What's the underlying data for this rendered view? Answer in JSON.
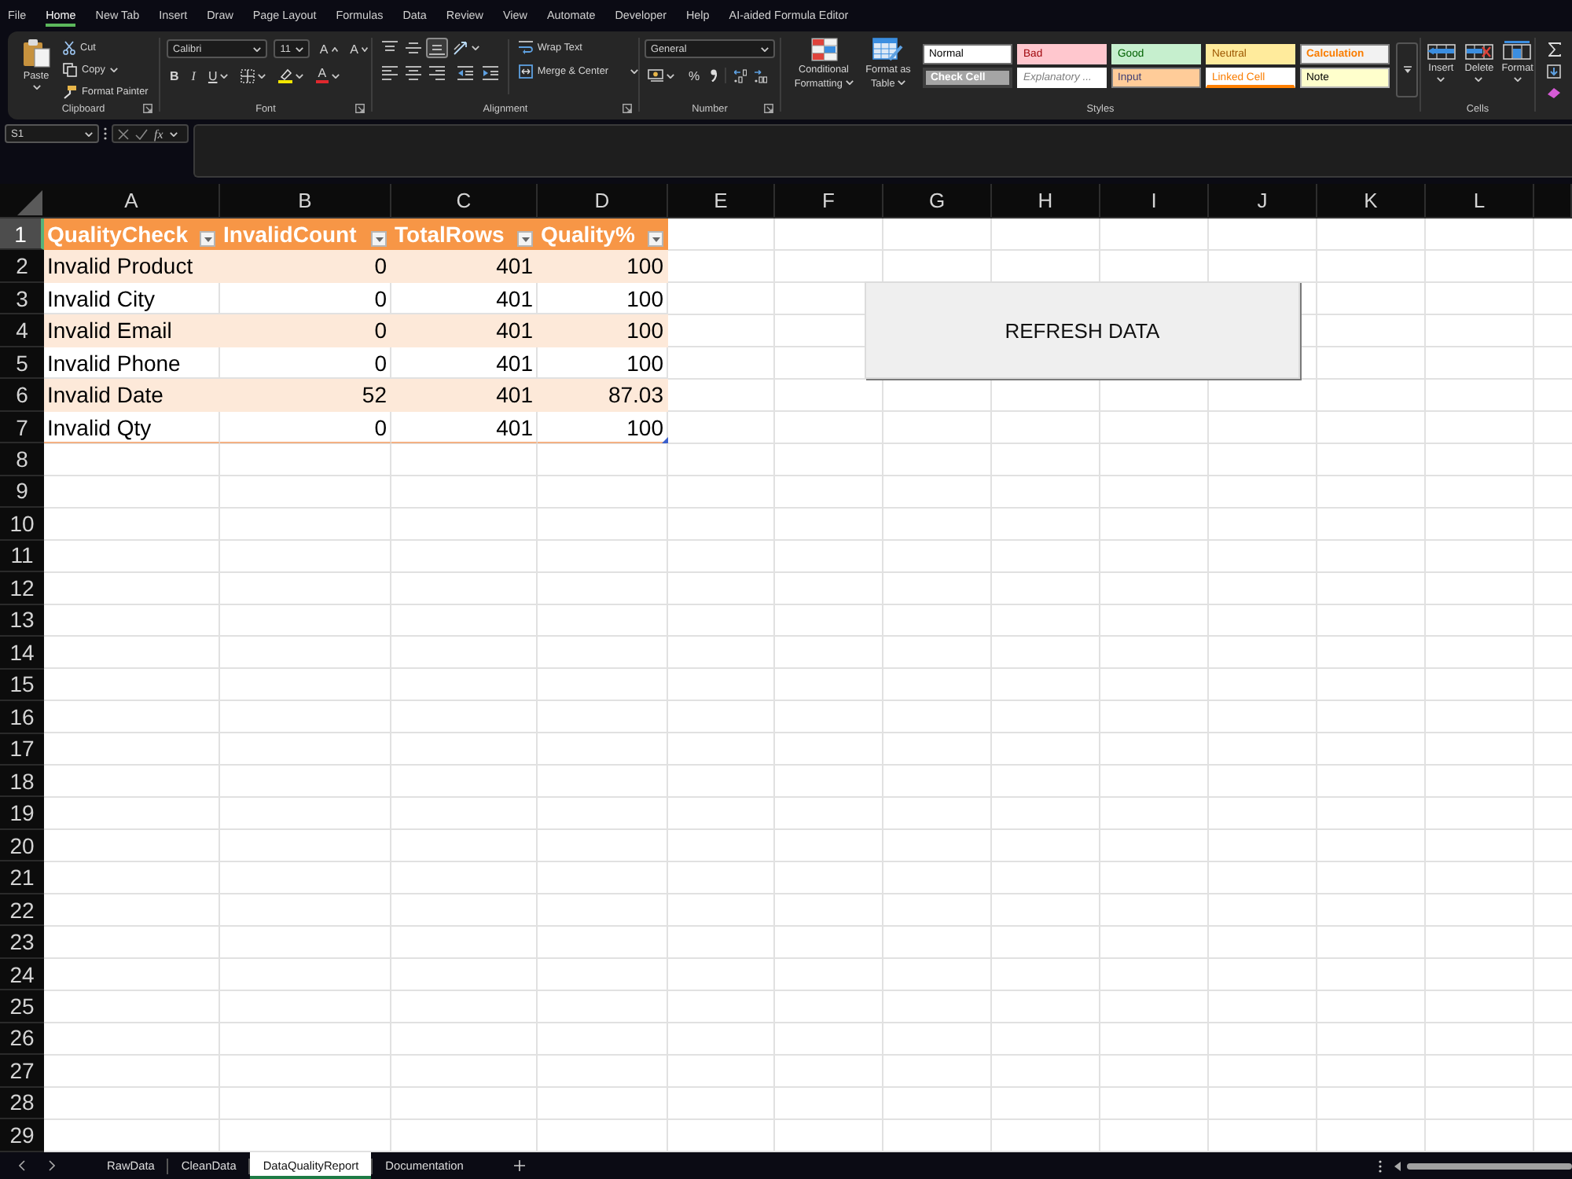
{
  "menu_tabs": [
    {
      "label": "File",
      "selected": false
    },
    {
      "label": "Home",
      "selected": true
    },
    {
      "label": "New Tab",
      "selected": false
    },
    {
      "label": "Insert",
      "selected": false
    },
    {
      "label": "Draw",
      "selected": false
    },
    {
      "label": "Page Layout",
      "selected": false
    },
    {
      "label": "Formulas",
      "selected": false
    },
    {
      "label": "Data",
      "selected": false
    },
    {
      "label": "Review",
      "selected": false
    },
    {
      "label": "View",
      "selected": false
    },
    {
      "label": "Automate",
      "selected": false
    },
    {
      "label": "Developer",
      "selected": false
    },
    {
      "label": "Help",
      "selected": false
    },
    {
      "label": "AI-aided Formula Editor",
      "selected": false
    }
  ],
  "ribbon": {
    "clipboard": {
      "label": "Clipboard",
      "paste": "Paste",
      "cut": "Cut",
      "copy": "Copy",
      "format_painter": "Format Painter"
    },
    "font": {
      "label": "Font",
      "font_name": "Calibri",
      "font_size": "11",
      "grow": "A",
      "shrink": "A",
      "bold": "B",
      "italic": "I",
      "underline": "U",
      "font_color": "A"
    },
    "alignment": {
      "label": "Alignment",
      "align_buttons": [
        {
          "kind": "top",
          "selected": false
        },
        {
          "kind": "middle",
          "selected": false
        },
        {
          "kind": "bottom",
          "selected": true
        },
        {
          "kind": "left",
          "selected": false
        },
        {
          "kind": "center",
          "selected": false
        },
        {
          "kind": "right",
          "selected": false
        }
      ],
      "wrap_text": "Wrap Text",
      "merge": "Merge & Center"
    },
    "number": {
      "label": "Number",
      "format": "General",
      "percent": "%"
    },
    "styles": {
      "label": "Styles",
      "conditional_formatting": "Conditional Formatting",
      "format_as_table": "Format as Table",
      "cell_styles": [
        {
          "label": "Normal",
          "kind": "normal"
        },
        {
          "label": "Bad",
          "kind": "bad"
        },
        {
          "label": "Good",
          "kind": "good"
        },
        {
          "label": "Neutral",
          "kind": "neutral"
        },
        {
          "label": "Calculation",
          "kind": "calculation"
        },
        {
          "label": "Check Cell",
          "kind": "check"
        },
        {
          "label": "Explanatory ...",
          "kind": "explanatory"
        },
        {
          "label": "Input",
          "kind": "input"
        },
        {
          "label": "Linked Cell",
          "kind": "linked"
        },
        {
          "label": "Note",
          "kind": "note"
        }
      ]
    },
    "cells": {
      "label": "Cells",
      "buttons": [
        {
          "kind": "insert",
          "label": "Insert"
        },
        {
          "kind": "delete",
          "label": "Delete"
        },
        {
          "kind": "format",
          "label": "Format"
        }
      ]
    }
  },
  "formula_bar": {
    "name_box": "S1",
    "fx": "fx"
  },
  "sheet": {
    "columns": [
      "A",
      "B",
      "C",
      "D",
      "E",
      "F",
      "G",
      "H",
      "I",
      "J",
      "K",
      "L"
    ],
    "rows": [
      {
        "label": "1",
        "selected": true
      },
      {
        "label": "2",
        "selected": false
      },
      {
        "label": "3",
        "selected": false
      },
      {
        "label": "4",
        "selected": false
      },
      {
        "label": "5",
        "selected": false
      },
      {
        "label": "6",
        "selected": false
      },
      {
        "label": "7",
        "selected": false
      },
      {
        "label": "8",
        "selected": false
      },
      {
        "label": "9",
        "selected": false
      },
      {
        "label": "10",
        "selected": false
      },
      {
        "label": "11",
        "selected": false
      },
      {
        "label": "12",
        "selected": false
      },
      {
        "label": "13",
        "selected": false
      },
      {
        "label": "14",
        "selected": false
      },
      {
        "label": "15",
        "selected": false
      },
      {
        "label": "16",
        "selected": false
      },
      {
        "label": "17",
        "selected": false
      },
      {
        "label": "18",
        "selected": false
      },
      {
        "label": "19",
        "selected": false
      },
      {
        "label": "20",
        "selected": false
      },
      {
        "label": "21",
        "selected": false
      },
      {
        "label": "22",
        "selected": false
      },
      {
        "label": "23",
        "selected": false
      },
      {
        "label": "24",
        "selected": false
      },
      {
        "label": "25",
        "selected": false
      },
      {
        "label": "26",
        "selected": false
      },
      {
        "label": "27",
        "selected": false
      },
      {
        "label": "28",
        "selected": false
      },
      {
        "label": "29",
        "selected": false
      }
    ],
    "table": {
      "columns": [
        "QualityCheck",
        "InvalidCount",
        "TotalRows",
        "Quality%"
      ],
      "rows": [
        [
          "Invalid Product",
          "0",
          "401",
          "100"
        ],
        [
          "Invalid City",
          "0",
          "401",
          "100"
        ],
        [
          "Invalid Email",
          "0",
          "401",
          "100"
        ],
        [
          "Invalid Phone",
          "0",
          "401",
          "100"
        ],
        [
          "Invalid Date",
          "52",
          "401",
          "87.03"
        ],
        [
          "Invalid Qty",
          "0",
          "401",
          "100"
        ]
      ]
    },
    "button": "REFRESH DATA"
  },
  "sheet_tabs": [
    {
      "label": "RawData",
      "selected": false
    },
    {
      "label": "CleanData",
      "selected": false
    },
    {
      "label": "DataQualityReport",
      "selected": true
    },
    {
      "label": "Documentation",
      "selected": false
    }
  ]
}
